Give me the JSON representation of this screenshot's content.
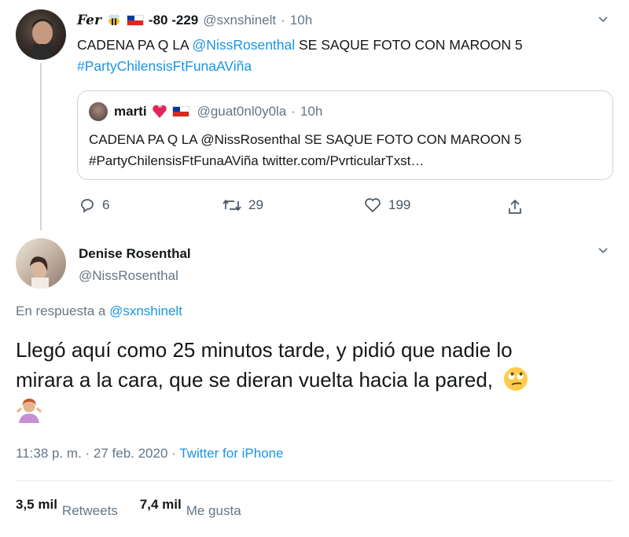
{
  "tweet1": {
    "display_name": "Fer",
    "name_suffix": "-80 -229",
    "handle": "@sxnshinelt",
    "time": "10h",
    "text_line1_prefix": "CADENA PA Q LA ",
    "mention": "@NissRosenthal",
    "text_line1_suffix": " SE SAQUE FOTO CON MAROON 5",
    "hashtag": "#PartyChilensisFtFunaAViña",
    "quote": {
      "display_name": "marti",
      "handle": "@guat0nl0y0la",
      "time": "10h",
      "line1": "CADENA PA Q LA @NissRosenthal SE SAQUE FOTO CON MAROON 5",
      "line2": "#PartyChilensisFtFunaAViña twitter.com/PvrticularTxst…"
    },
    "replies": "6",
    "retweets": "29",
    "likes": "199"
  },
  "tweet2": {
    "display_name": "Denise Rosenthal",
    "handle": "@NissRosenthal",
    "reply_prefix": "En respuesta a ",
    "reply_to": "@sxnshinelt",
    "text_line1": "Llegó aquí como 25 minutos tarde, y pidió que nadie lo",
    "text_line2": "mirara a la cara, que se dieran vuelta hacia la pared,",
    "timestamp": "11:38 p. m. · 27 feb. 2020 · ",
    "source": "Twitter for iPhone",
    "retweet_count": "3,5 mil",
    "retweet_label": "Retweets",
    "like_count": "7,4 mil",
    "like_label": "Me gusta"
  },
  "colors": {
    "link": "#1b95e0",
    "muted": "#657786",
    "border": "#ccd6dd"
  },
  "icons": [
    "reply-icon",
    "retweet-icon",
    "heart-icon",
    "share-icon",
    "chevron-down-icon",
    "bee-icon",
    "chile-flag-icon",
    "heart-emoji-icon",
    "eye-roll-emoji-icon",
    "shrug-emoji-icon"
  ]
}
